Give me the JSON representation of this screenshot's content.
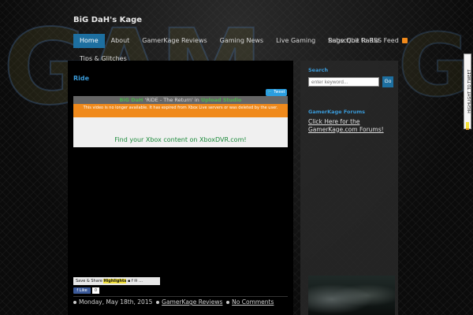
{
  "site": {
    "title": "BiG DaH's Kage",
    "logo_text": "GAMERKAGE"
  },
  "nav": {
    "items": [
      {
        "label": "Home",
        "active": true
      },
      {
        "label": "About"
      },
      {
        "label": "GamerKage Reviews"
      },
      {
        "label": "Gaming News"
      },
      {
        "label": "Live Gaming"
      },
      {
        "label": "Rage Quit Radio"
      }
    ],
    "row2": [
      {
        "label": "Tips & Glitches"
      }
    ],
    "rss_label": "Subscribe to RSS Feed"
  },
  "post": {
    "title": "Ride",
    "tweet_label": "Tweet",
    "video": {
      "header_user": "BiG DaH",
      "header_middle": " 'RiDE - The Return' in ",
      "header_link": "Upload Studio",
      "notice": "This video is no longer available. It has expired from Xbox Live servers or was deleted by the user.",
      "link_text": "Find your Xbox content on XboxDVR.com!"
    },
    "share": {
      "prefix": "Save & Share ",
      "highlight": "Highlights"
    },
    "like": {
      "label": "Like",
      "count": "0"
    },
    "meta": {
      "date": "Monday, May 18th, 2015",
      "category": "GamerKage Reviews",
      "comments": "No Comments"
    }
  },
  "sidebar": {
    "search": {
      "title": "Search",
      "placeholder": "enter keyword...",
      "button": "Go"
    },
    "forums": {
      "title": "GamerKage Forums",
      "link": "Click Here for the GamerKage.com Forums!"
    }
  },
  "side_tab": {
    "label": "HIGHLIGHT TO TWEET"
  },
  "colors": {
    "accent": "#1d6fa0",
    "link_blue": "#3a9ad8",
    "notice_orange": "#f08a1c"
  }
}
